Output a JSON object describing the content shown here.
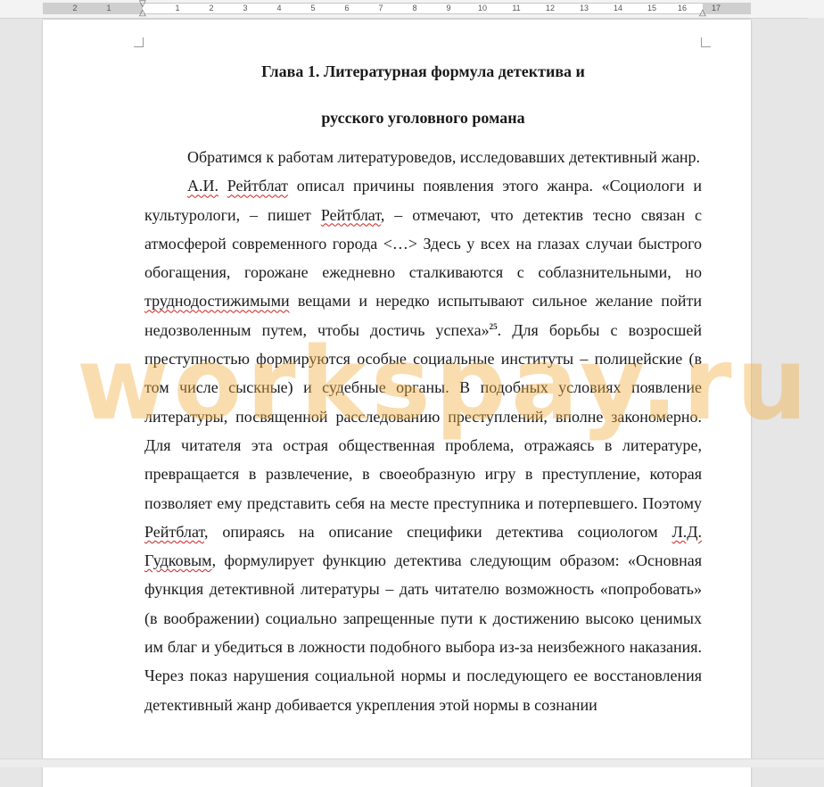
{
  "ruler": {
    "numbers": [
      "2",
      "1",
      "1",
      "2",
      "3",
      "4",
      "5",
      "6",
      "7",
      "8",
      "9",
      "10",
      "11",
      "12",
      "13",
      "14",
      "15",
      "16",
      "17"
    ]
  },
  "document": {
    "heading_line1": "Глава 1. Литературная формула детектива и",
    "heading_line2": "русского уголовного романа",
    "para1": "Обратимся к работам литературоведов, исследовавших детективный жанр.",
    "para2": {
      "s1": "А.И.",
      "s2": " ",
      "s3": "Рейтблат",
      "s4": " описал причины появления этого жанра. «Социологи и культурологи, – пишет ",
      "s5": "Рейтблат",
      "s6": ", – отмечают, что детектив тесно связан с атмосферой современного города <…> Здесь у всех на глазах случаи быстрого обогащения, горожане ежедневно сталкиваются с соблазнительными, но ",
      "s7": "труднодостижимыми",
      "s8": " вещами и нередко испытывают сильное желание пойти недозволенным путем, чтобы достичь успеха»",
      "footnote": "25",
      "s9": ". Для борьбы с возросшей преступностью формируются особые социальные институты – полицейские (в том числе сыскные) и судебные органы. В подобных условиях появление литературы, посвященной расследованию преступлений, вполне закономерно. Для читателя эта острая общественная проблема, отражаясь в литературе, превращается в развлечение, в своеобразную игру в преступление, которая позволяет ему представить себя на месте преступника и потерпевшего. Поэтому ",
      "s10": "Рейтблат",
      "s11": ", опираясь на описание специфики детектива социологом ",
      "s12": "Л.Д.",
      "s13": " ",
      "s14": "Гудковым",
      "s15": ", формулирует функцию детектива следующим образом: «Основная функция детективной литературы – дать читателю возможность «попробовать» (в воображении) социально запрещенные пути к достижению высоко ценимых им благ и убедиться в ложности подобного выбора из-за неизбежного наказания. Через показ нарушения социальной нормы и последующего ее восстановления детективный жанр добивается укрепления этой нормы в сознании"
    }
  },
  "watermark": "workspay.ru"
}
